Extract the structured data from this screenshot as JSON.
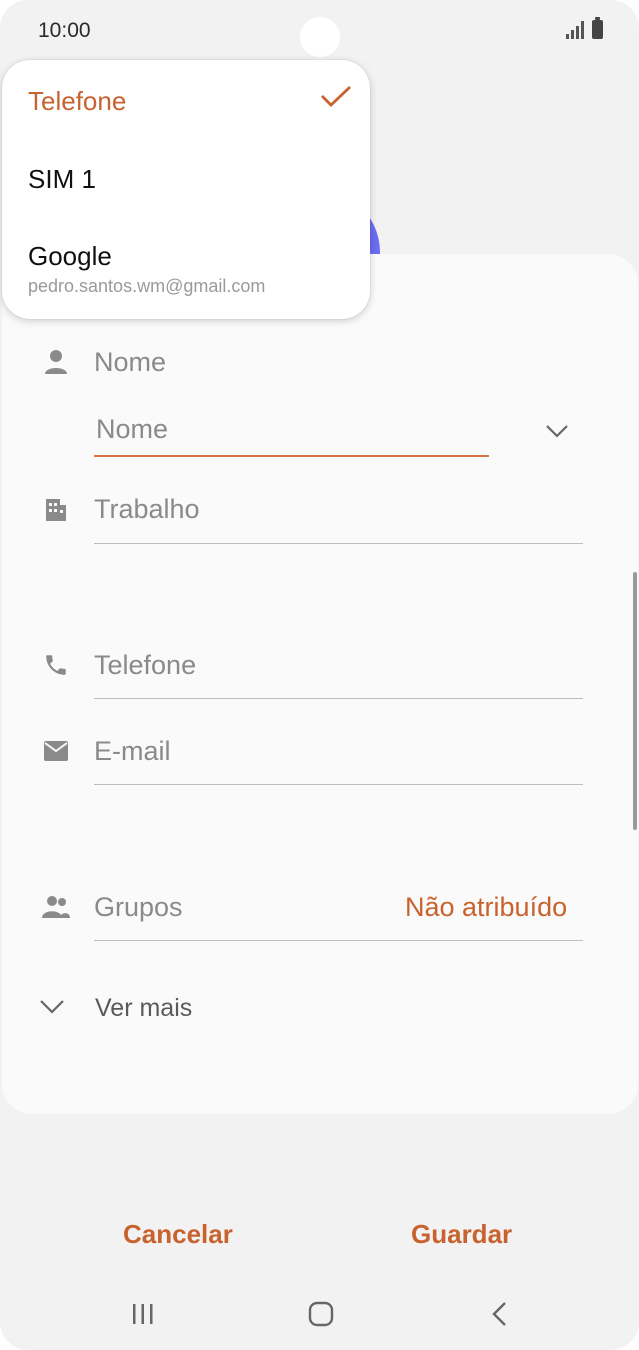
{
  "status_bar": {
    "time": "10:00"
  },
  "menu": {
    "items": [
      {
        "label": "Telefone",
        "selected": true
      },
      {
        "label": "SIM 1",
        "selected": false
      },
      {
        "label": "Google",
        "sublabel": "pedro.santos.wm@gmail.com",
        "selected": false
      }
    ]
  },
  "form": {
    "name_label": "Nome",
    "name_placeholder": "Nome",
    "work_label": "Trabalho",
    "phone_label": "Telefone",
    "email_label": "E-mail",
    "groups_label": "Grupos",
    "groups_value": "Não atribuído",
    "see_more_label": "Ver mais"
  },
  "actions": {
    "cancel_label": "Cancelar",
    "save_label": "Guardar"
  },
  "colors": {
    "accent": "#c8622e",
    "avatar": "#6b6cf2",
    "card": "#fafafa",
    "background": "#f2f2f2"
  }
}
